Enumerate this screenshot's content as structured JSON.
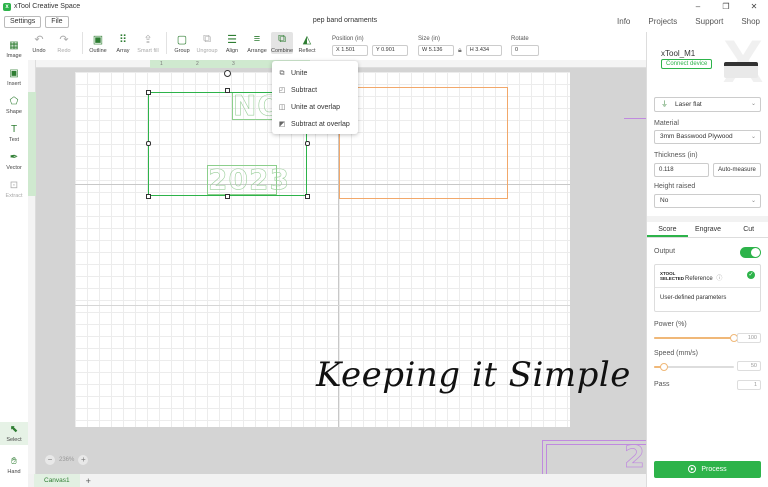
{
  "app": {
    "title": "xTool Creative Space",
    "logo_letter": "x",
    "window_controls": [
      "–",
      "❐",
      "✕"
    ]
  },
  "menu": {
    "settings": "Settings",
    "file": "File",
    "doc_title": "pep band ornaments",
    "right": [
      "Info",
      "Projects",
      "Support",
      "Shop"
    ]
  },
  "toolbar": {
    "undo": "Undo",
    "redo": "Redo",
    "outline": "Outline",
    "array": "Array",
    "smart_fill": "Smart fill",
    "group": "Group",
    "ungroup": "Ungroup",
    "align": "Align",
    "arrange": "Arrange",
    "combine": "Combine",
    "reflect": "Reflect"
  },
  "position": {
    "label": "Position (in)",
    "x": "X 1.501",
    "y": "Y 0.901"
  },
  "size": {
    "label": "Size (in)",
    "w": "W 5.136",
    "h": "H 3.434"
  },
  "rotate": {
    "label": "Rotate",
    "value": "0"
  },
  "left_tools": {
    "image": "Image",
    "insert": "Insert",
    "shape": "Shape",
    "text": "Text",
    "vector": "Vector",
    "extract": "Extract",
    "select": "Select",
    "hand": "Hand"
  },
  "combine_menu": [
    "Unite",
    "Subtract",
    "Unite at overlap",
    "Subtract at overlap"
  ],
  "canvas": {
    "text_top": "NO",
    "text_bottom": "2023",
    "handwriting": "Keeping it Simple",
    "purple_text": "2",
    "zoom": "236%",
    "zoom_minus": "−",
    "zoom_plus": "+",
    "ruler_marks": [
      "1",
      "2",
      "3"
    ]
  },
  "bottom": {
    "tab": "Canvas1",
    "add": "+"
  },
  "device": {
    "name": "xTool_M1",
    "connect": "Connect device"
  },
  "settings_panel": {
    "mode": "Laser flat",
    "material_label": "Material",
    "material": "3mm Basswood Plywood",
    "thickness_label": "Thickness (in)",
    "thickness": "0.118",
    "auto_measure": "Auto-measure",
    "height_label": "Height raised",
    "height": "No",
    "tabs": [
      "Score",
      "Engrave",
      "Cut"
    ],
    "output_label": "Output",
    "xtool_selected": "XTOOL SELECTED",
    "reference": "Reference",
    "info_icon": "ⓘ",
    "user_defined": "User-defined parameters",
    "power_label": "Power (%)",
    "power": 100,
    "speed_label": "Speed (mm/s)",
    "speed": 50,
    "pass_label": "Pass",
    "pass": "1",
    "process": "Process"
  },
  "colors": {
    "accent": "#2db34a",
    "selection": "#2db34a",
    "orange": "#f2a86a",
    "purple": "#c08adf"
  }
}
